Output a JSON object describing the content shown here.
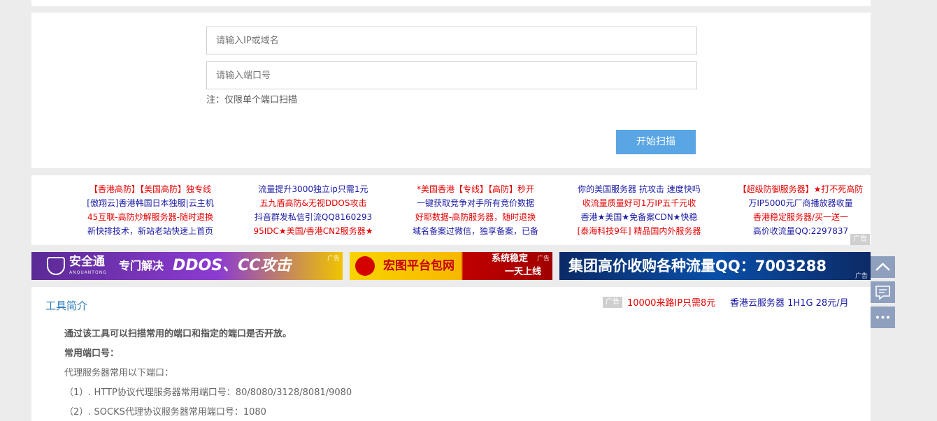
{
  "scan_form": {
    "ip_placeholder": "请输入IP或域名",
    "port_placeholder": "请输入端口号",
    "note": "注：仅限单个端口扫描",
    "start_button": "开始扫描"
  },
  "link_ads": {
    "columns": [
      {
        "items": [
          {
            "text": "【香港高防】【美国高防】独专线",
            "color": "red"
          },
          {
            "text": "[傲翔云]香港韩国日本独服|云主机",
            "color": "blue"
          },
          {
            "text": "45互联-高防炒解服务器-随时退换",
            "color": "red"
          },
          {
            "text": "新快排技术，新站老站快速上首页",
            "color": "blue"
          }
        ]
      },
      {
        "items": [
          {
            "text": "流量提升3000独立ip只需1元",
            "color": "blue"
          },
          {
            "text": "五九盾高防&无视DDOS攻击",
            "color": "red"
          },
          {
            "text": "抖音群发私信引流QQ8160293",
            "color": "blue"
          },
          {
            "text": "95IDC★美国/香港CN2服务器★",
            "color": "red"
          }
        ]
      },
      {
        "items": [
          {
            "text": "*美国香港【专线】【高防】秒开",
            "color": "red"
          },
          {
            "text": "一键获取竞争对手所有竞价数据",
            "color": "blue"
          },
          {
            "text": "好耶数据-高防服务器，随时退换",
            "color": "red"
          },
          {
            "text": "域名备案过微信，独享备案，已备",
            "color": "blue"
          }
        ]
      },
      {
        "items": [
          {
            "text": "你的美国服务器 抗攻击 速度快吗",
            "color": "blue"
          },
          {
            "text": "收流量质量好可1万IP五千元收",
            "color": "red"
          },
          {
            "text": "香港★美国★免备案CDN★快稳",
            "color": "blue"
          },
          {
            "text": "[泰海科技9年] 精品国内外服务器",
            "color": "red"
          }
        ]
      },
      {
        "items": [
          {
            "text": "【超级防御服务器】★打不死高防",
            "color": "red"
          },
          {
            "text": "万IP5000元厂商播放器收量",
            "color": "blue"
          },
          {
            "text": "香港稳定服务器/买一送一",
            "color": "red"
          },
          {
            "text": "高价收流量QQ:2297837",
            "color": "blue"
          }
        ]
      }
    ],
    "ad_tag": "广告"
  },
  "banners": {
    "banner1": {
      "brand": "安全通",
      "brand_sub": "ANQUANTONG",
      "slogan": "专门解决",
      "highlight": "DDOS、CC攻击",
      "ad": "广告"
    },
    "banner2": {
      "name": "宏图平台包网",
      "line1": "系统稳定",
      "line2": "一天上线",
      "ad": "广告"
    },
    "banner3": {
      "text": "集团高价收购各种流量QQ：7003288",
      "ad": "广告"
    }
  },
  "intro": {
    "title": "工具简介",
    "ad_tag": "广告",
    "ad_link_1": "10000来路IP只需8元",
    "ad_link_2": "香港云服务器 1H1G 28元/月",
    "lines": [
      "通过该工具可以扫描常用的端口和指定的端口是否开放。",
      "常用端口号：",
      "代理服务器常用以下端口：",
      "（1）. HTTP协议代理服务器常用端口号：80/8080/3128/8081/9080",
      "（2）. SOCKS代理协议服务器常用端口号：1080"
    ]
  },
  "sidebar": {
    "icons": [
      "chevron-up-icon",
      "chat-icon",
      "more-icon"
    ]
  },
  "colors": {
    "accent": "#5aa6e4",
    "link_red": "#e60000",
    "link_blue": "#1a1aa6",
    "side_button": "#8ea0bd",
    "title_blue": "#2a7ab8"
  }
}
